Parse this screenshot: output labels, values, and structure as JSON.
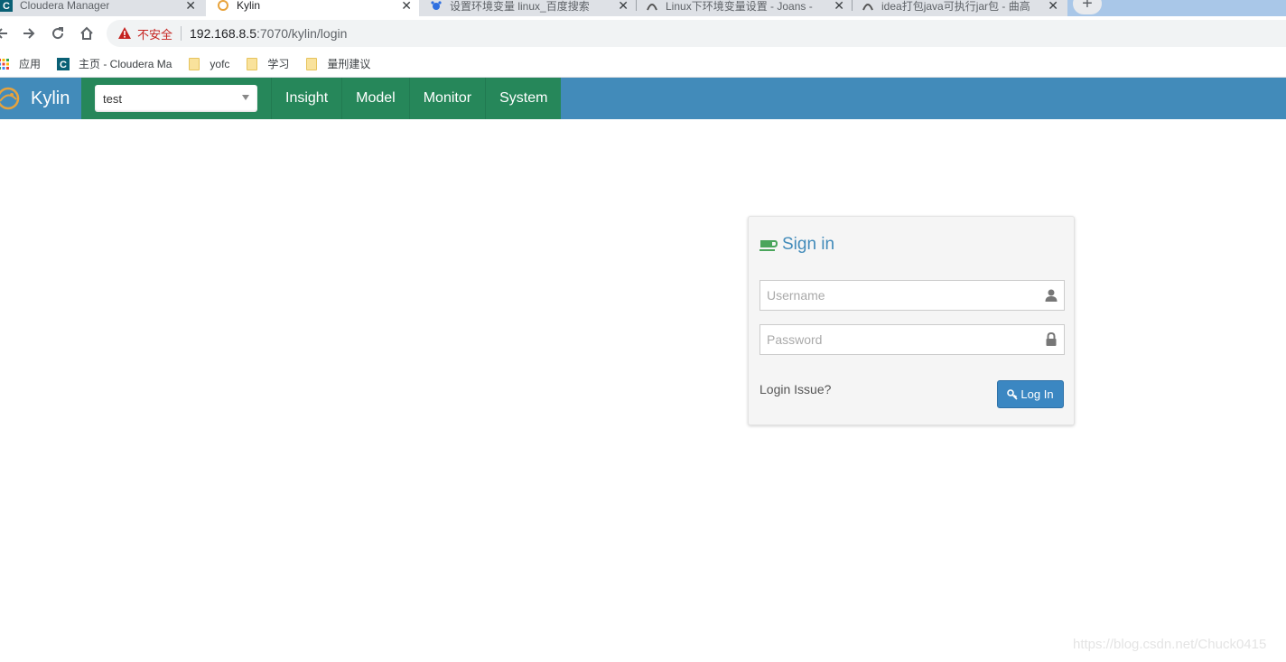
{
  "browser": {
    "tabs": [
      {
        "title": "Cloudera Manager",
        "active": false
      },
      {
        "title": "Kylin",
        "active": true
      },
      {
        "title": "设置环境变量 linux_百度搜索",
        "active": false
      },
      {
        "title": "Linux下环境变量设置 - Joans - ",
        "active": false
      },
      {
        "title": "idea打包java可执行jar包 - 曲高",
        "active": false
      }
    ],
    "address": {
      "security_label": "不安全",
      "host": "192.168.8.5",
      "path": ":7070/kylin/login"
    },
    "bookmarks": [
      {
        "label": "应用",
        "icon": "apps-grid-icon"
      },
      {
        "label": "主页 - Cloudera Ma",
        "icon": "cloudera-icon"
      },
      {
        "label": "yofc",
        "icon": "folder-icon"
      },
      {
        "label": "学习",
        "icon": "folder-icon"
      },
      {
        "label": "量刑建议",
        "icon": "folder-icon"
      }
    ]
  },
  "app": {
    "brand": "Kylin",
    "project_selected": "test",
    "nav": [
      "Insight",
      "Model",
      "Monitor",
      "System"
    ],
    "colors": {
      "header": "#428bba",
      "nav_bg": "#26875a",
      "button": "#3b87c2"
    }
  },
  "signin": {
    "title": "Sign in",
    "username_placeholder": "Username",
    "password_placeholder": "Password",
    "login_issue": "Login Issue?",
    "login_button": "Log In"
  },
  "watermark": "https://blog.csdn.net/Chuck0415"
}
